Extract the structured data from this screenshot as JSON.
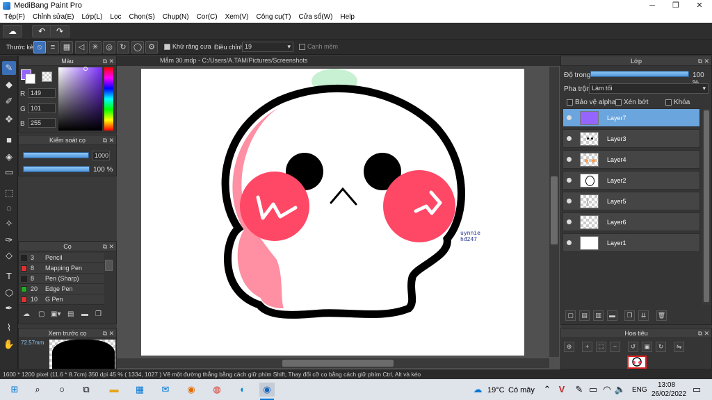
{
  "window": {
    "title": "MediBang Paint Pro",
    "minimize": "─",
    "maximize": "❐",
    "close": "✕"
  },
  "menu": [
    "Tệp(F)",
    "Chỉnh sửa(E)",
    "Lớp(L)",
    "Lọc",
    "Chọn(S)",
    "Chụp(N)",
    "Cor(C)",
    "Xem(V)",
    "Công cụ(T)",
    "Cửa sổ(W)",
    "Help"
  ],
  "toolbar2": {
    "ruler_label": "Thước kẻ",
    "antialias_label": "Khử răng cưa",
    "adjust_label": "Điều chỉnh",
    "adjust_value": "19",
    "smooth_label": "Cạnh mềm"
  },
  "color_panel": {
    "title": "Màu",
    "r_label": "R",
    "r": "149",
    "g_label": "G",
    "g": "101",
    "b_label": "B",
    "b": "255",
    "primary_color": "#9565ff"
  },
  "brush_control": {
    "title": "Kiểm soát cọ",
    "size": "1000",
    "opacity": "100 %"
  },
  "brush_panel": {
    "title": "Cọ",
    "items": [
      {
        "size": "3",
        "name": "Pencil",
        "color": "#222222"
      },
      {
        "size": "8",
        "name": "Mapping Pen",
        "color": "#e03030"
      },
      {
        "size": "8",
        "name": "Pen (Sharp)",
        "color": "#222222"
      },
      {
        "size": "20",
        "name": "Edge Pen",
        "color": "#22aa22"
      },
      {
        "size": "10",
        "name": "G Pen",
        "color": "#e03030"
      }
    ]
  },
  "brush_preview": {
    "title": "Xem trước cọ",
    "size_text": "72.57mm"
  },
  "document": {
    "tab": "Mắm 30.mdp - C:/Users/A.TAM/Pictures/Screenshots",
    "signature": "uynnie hđ247"
  },
  "layers_panel": {
    "title": "Lớp",
    "opacity_label": "Độ trong",
    "opacity_value": "100 %",
    "blend_label": "Pha trộn",
    "blend_value": "Làm tối",
    "protect_alpha": "Bảo vệ alpha",
    "clipping": "Xén bớt",
    "lock": "Khóa",
    "layers": [
      {
        "name": "Layer7",
        "selected": true
      },
      {
        "name": "Layer3",
        "selected": false
      },
      {
        "name": "Layer4",
        "selected": false
      },
      {
        "name": "Layer2",
        "selected": false
      },
      {
        "name": "Layer5",
        "selected": false
      },
      {
        "name": "Layer6",
        "selected": false
      },
      {
        "name": "Layer1",
        "selected": false
      }
    ]
  },
  "navigator": {
    "title": "Hoa tiêu"
  },
  "statusbar": {
    "dimensions": "1600 * 1200 pixel",
    "size_cm": "(11.6 * 8.7cm)",
    "dpi": "350 dpi",
    "zoom": "45 %",
    "cursor": "( 1334, 1027 )",
    "hint": "Vẽ một đường thẳng bằng cách giữ phím Shift, Thay đổi cỡ cọ bằng cách giữ phím Ctrl, Alt và kéo"
  },
  "taskbar": {
    "weather_temp": "19°C",
    "weather_text": "Có mây",
    "lang": "ENG",
    "time": "13:08",
    "date": "26/02/2022"
  }
}
